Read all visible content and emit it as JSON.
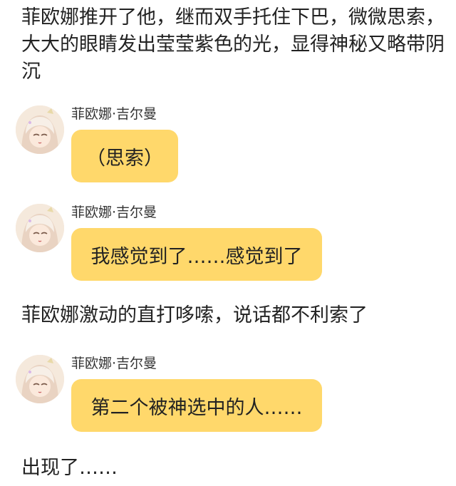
{
  "colors": {
    "bubble": "#FFD86B",
    "background": "#ffffff",
    "text": "#222222"
  },
  "narration": {
    "intro": "菲欧娜推开了他，继而双手托住下巴，微微思索，大大的眼睛发出莹莹紫色的光，显得神秘又略带阴沉",
    "middle": "菲欧娜激动的直打哆嗦，说话都不利索了",
    "ending": "出现了……"
  },
  "messages": [
    {
      "speaker": "菲欧娜·吉尔曼",
      "text": "（思索）",
      "avatar_icon": "character-avatar"
    },
    {
      "speaker": "菲欧娜·吉尔曼",
      "text": "我感觉到了……感觉到了",
      "avatar_icon": "character-avatar"
    },
    {
      "speaker": "菲欧娜·吉尔曼",
      "text": "第二个被神选中的人……",
      "avatar_icon": "character-avatar"
    }
  ]
}
